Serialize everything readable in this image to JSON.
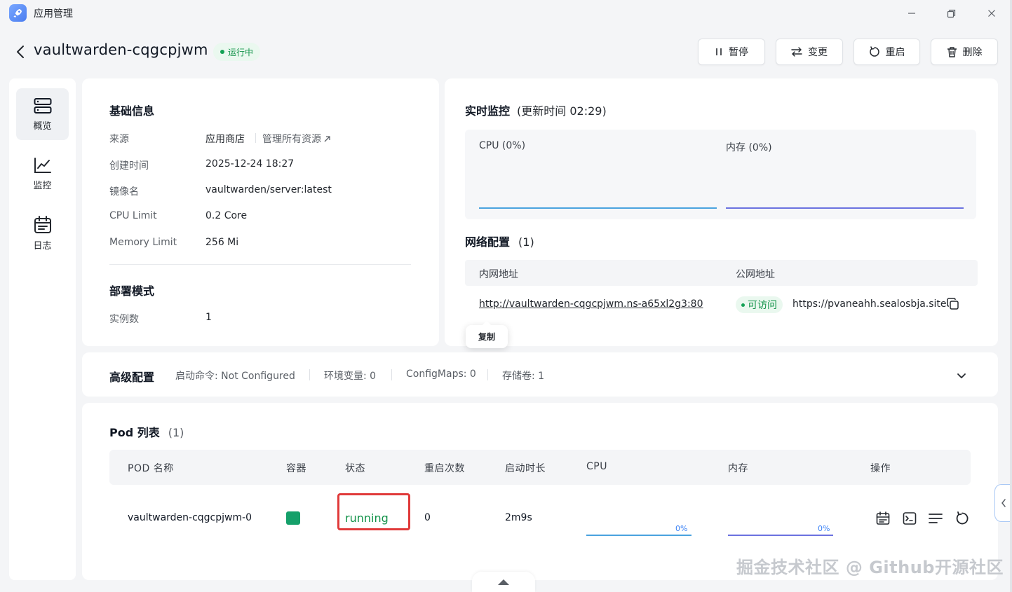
{
  "window": {
    "title": "应用管理"
  },
  "header": {
    "app_name": "vaultwarden-cqgcpjwm",
    "status": "运行中",
    "buttons": {
      "pause": "暂停",
      "change": "变更",
      "restart": "重启",
      "delete": "删除"
    }
  },
  "sidebar": {
    "items": [
      {
        "label": "概览",
        "icon": "overview-icon",
        "active": true
      },
      {
        "label": "监控",
        "icon": "chart-icon",
        "active": false
      },
      {
        "label": "日志",
        "icon": "calendar-icon",
        "active": false
      }
    ]
  },
  "basic_info": {
    "title": "基础信息",
    "source_label": "来源",
    "source_value": "应用商店",
    "manage_link": "管理所有资源",
    "created_label": "创建时间",
    "created_value": "2025-12-24 18:27",
    "image_label": "镜像名",
    "image_value": "vaultwarden/server:latest",
    "cpu_label": "CPU Limit",
    "cpu_value": "0.2 Core",
    "mem_label": "Memory Limit",
    "mem_value": "256 Mi"
  },
  "deploy": {
    "title": "部署模式",
    "replicas_label": "实例数",
    "replicas_value": "1"
  },
  "monitor": {
    "title": "实时监控",
    "updated": "(更新时间  02:29)",
    "cpu_label": "CPU  (0%)",
    "mem_label": "内存  (0%)",
    "cpu_color": "#4aa3df",
    "mem_color": "#6b72e0"
  },
  "network": {
    "title": "网络配置",
    "count": "(1)",
    "internal_header": "内网地址",
    "public_header": "公网地址",
    "internal_url": "http://vaultwarden-cqgcpjwm.ns-a65xl2g3:80",
    "access_status": "可访问",
    "public_url": "https://pvaneahh.sealosbja.site",
    "copy_tooltip": "复制"
  },
  "advanced": {
    "title": "高级配置",
    "start_cmd": "启动命令: Not Configured",
    "env": "环境变量: 0",
    "configmaps": "ConfigMaps: 0",
    "storage": "存储卷: 1"
  },
  "pods": {
    "title": "Pod 列表",
    "count": "(1)",
    "columns": [
      "POD 名称",
      "容器",
      "状态",
      "重启次数",
      "启动时长",
      "CPU",
      "内存",
      "操作"
    ],
    "rows": [
      {
        "name": "vaultwarden-cqgcpjwm-0",
        "status": "running",
        "restarts": "0",
        "uptime": "2m9s",
        "cpu_pct": "0%",
        "mem_pct": "0%"
      }
    ]
  },
  "watermark": "掘金技术社区 @ Github开源社区"
}
